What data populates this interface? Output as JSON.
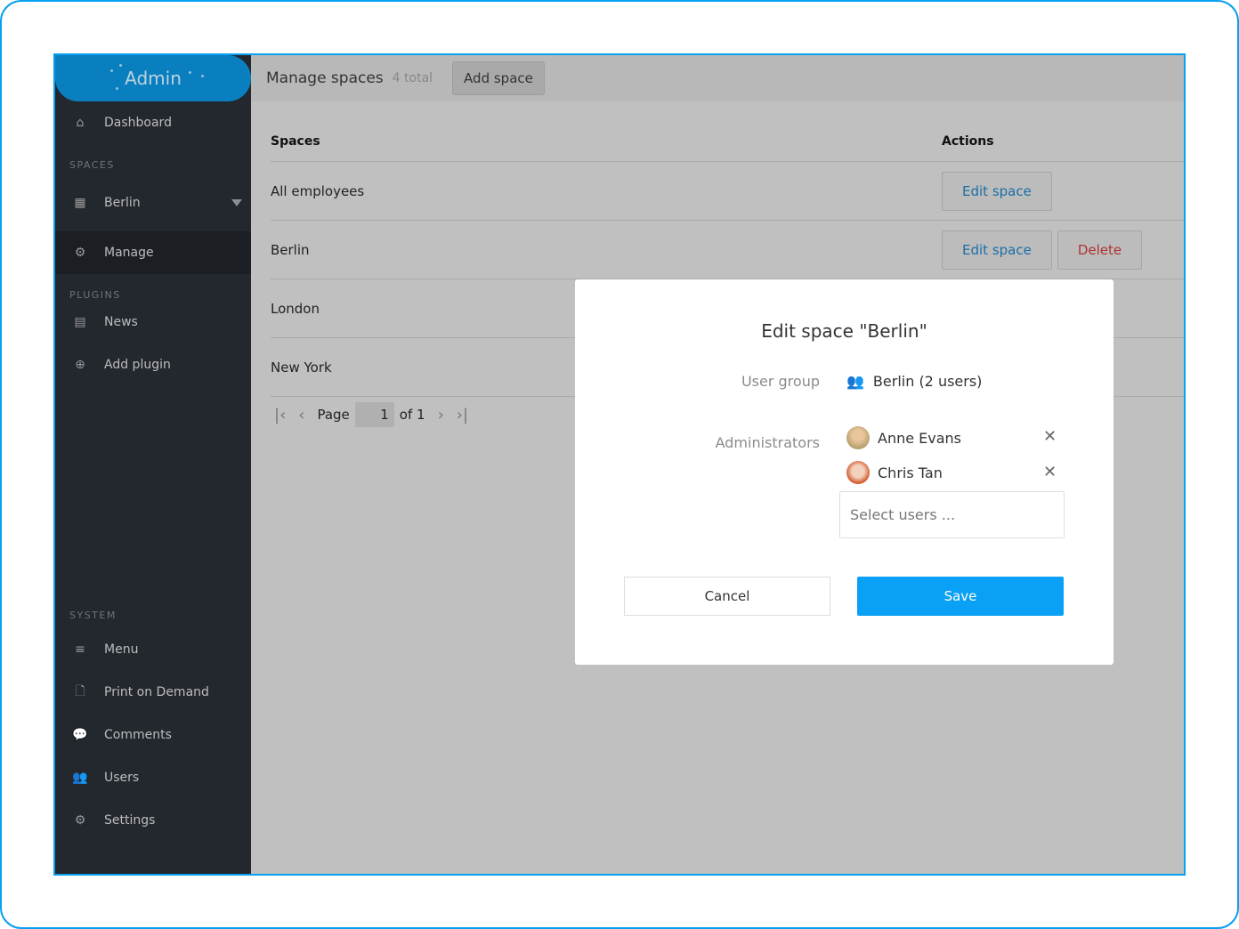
{
  "sidebar": {
    "logo": "Admin",
    "dashboard": "Dashboard",
    "sec_spaces": "SPACES",
    "berlin": "Berlin",
    "manage": "Manage",
    "sec_plugins": "PLUGINS",
    "news": "News",
    "add_plugin": "Add plugin",
    "sec_system": "SYSTEM",
    "menu": "Menu",
    "print": "Print on Demand",
    "comments": "Comments",
    "users": "Users",
    "settings": "Settings"
  },
  "header": {
    "title": "Manage spaces",
    "count": "4 total",
    "add_button": "Add space"
  },
  "table": {
    "col_spaces": "Spaces",
    "col_actions": "Actions",
    "rows": [
      {
        "name": "All employees",
        "edit": "Edit space"
      },
      {
        "name": "Berlin",
        "edit": "Edit space",
        "delete": "Delete"
      },
      {
        "name": "London"
      },
      {
        "name": "New York"
      }
    ]
  },
  "pager": {
    "label": "Page",
    "current": "1",
    "of": "of 1"
  },
  "modal": {
    "title": "Edit space \"Berlin\"",
    "user_group_label": "User group",
    "user_group": "Berlin (2 users)",
    "admins_label": "Administrators",
    "admins": [
      {
        "name": "Anne Evans"
      },
      {
        "name": "Chris Tan"
      }
    ],
    "select_placeholder": "Select users ...",
    "cancel": "Cancel",
    "save": "Save"
  },
  "colors": {
    "accent": "#09a0f5",
    "frame": "#0aa0f0",
    "sidebar": "#23272e",
    "delete": "#b03333"
  }
}
